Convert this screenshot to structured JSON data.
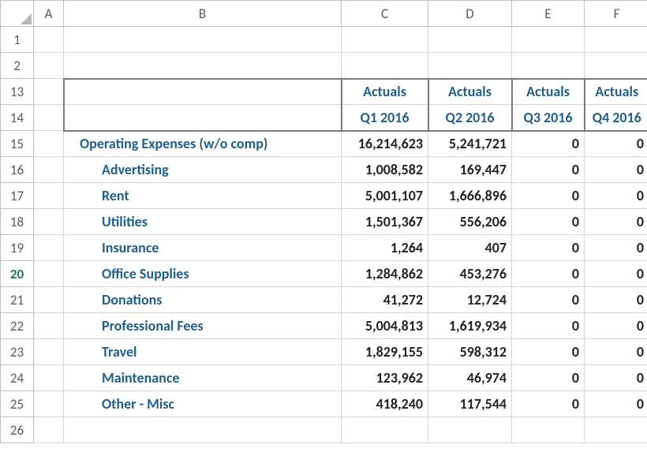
{
  "columns": [
    "A",
    "B",
    "C",
    "D",
    "E",
    "F"
  ],
  "row_numbers": [
    "1",
    "2",
    "13",
    "14",
    "15",
    "16",
    "17",
    "18",
    "19",
    "20",
    "21",
    "22",
    "23",
    "24",
    "25",
    "26"
  ],
  "selected_row": "20",
  "headers": {
    "label": "Actuals",
    "quarters": [
      "Q1 2016",
      "Q2 2016",
      "Q3 2016",
      "Q4 2016"
    ]
  },
  "rows": [
    {
      "name": "Operating Expenses (w/o comp)",
      "level": 1,
      "values": [
        "16,214,623",
        "5,241,721",
        "0",
        "0"
      ]
    },
    {
      "name": "Advertising",
      "level": 2,
      "values": [
        "1,008,582",
        "169,447",
        "0",
        "0"
      ]
    },
    {
      "name": "Rent",
      "level": 2,
      "values": [
        "5,001,107",
        "1,666,896",
        "0",
        "0"
      ]
    },
    {
      "name": "Utilities",
      "level": 2,
      "values": [
        "1,501,367",
        "556,206",
        "0",
        "0"
      ]
    },
    {
      "name": "Insurance",
      "level": 2,
      "values": [
        "1,264",
        "407",
        "0",
        "0"
      ]
    },
    {
      "name": "Office Supplies",
      "level": 2,
      "values": [
        "1,284,862",
        "453,276",
        "0",
        "0"
      ]
    },
    {
      "name": "Donations",
      "level": 2,
      "values": [
        "41,272",
        "12,724",
        "0",
        "0"
      ]
    },
    {
      "name": "Professional Fees",
      "level": 2,
      "values": [
        "5,004,813",
        "1,619,934",
        "0",
        "0"
      ]
    },
    {
      "name": "Travel",
      "level": 2,
      "values": [
        "1,829,155",
        "598,312",
        "0",
        "0"
      ]
    },
    {
      "name": "Maintenance",
      "level": 2,
      "values": [
        "123,962",
        "46,974",
        "0",
        "0"
      ]
    },
    {
      "name": "Other - Misc",
      "level": 2,
      "values": [
        "418,240",
        "117,544",
        "0",
        "0"
      ]
    }
  ]
}
